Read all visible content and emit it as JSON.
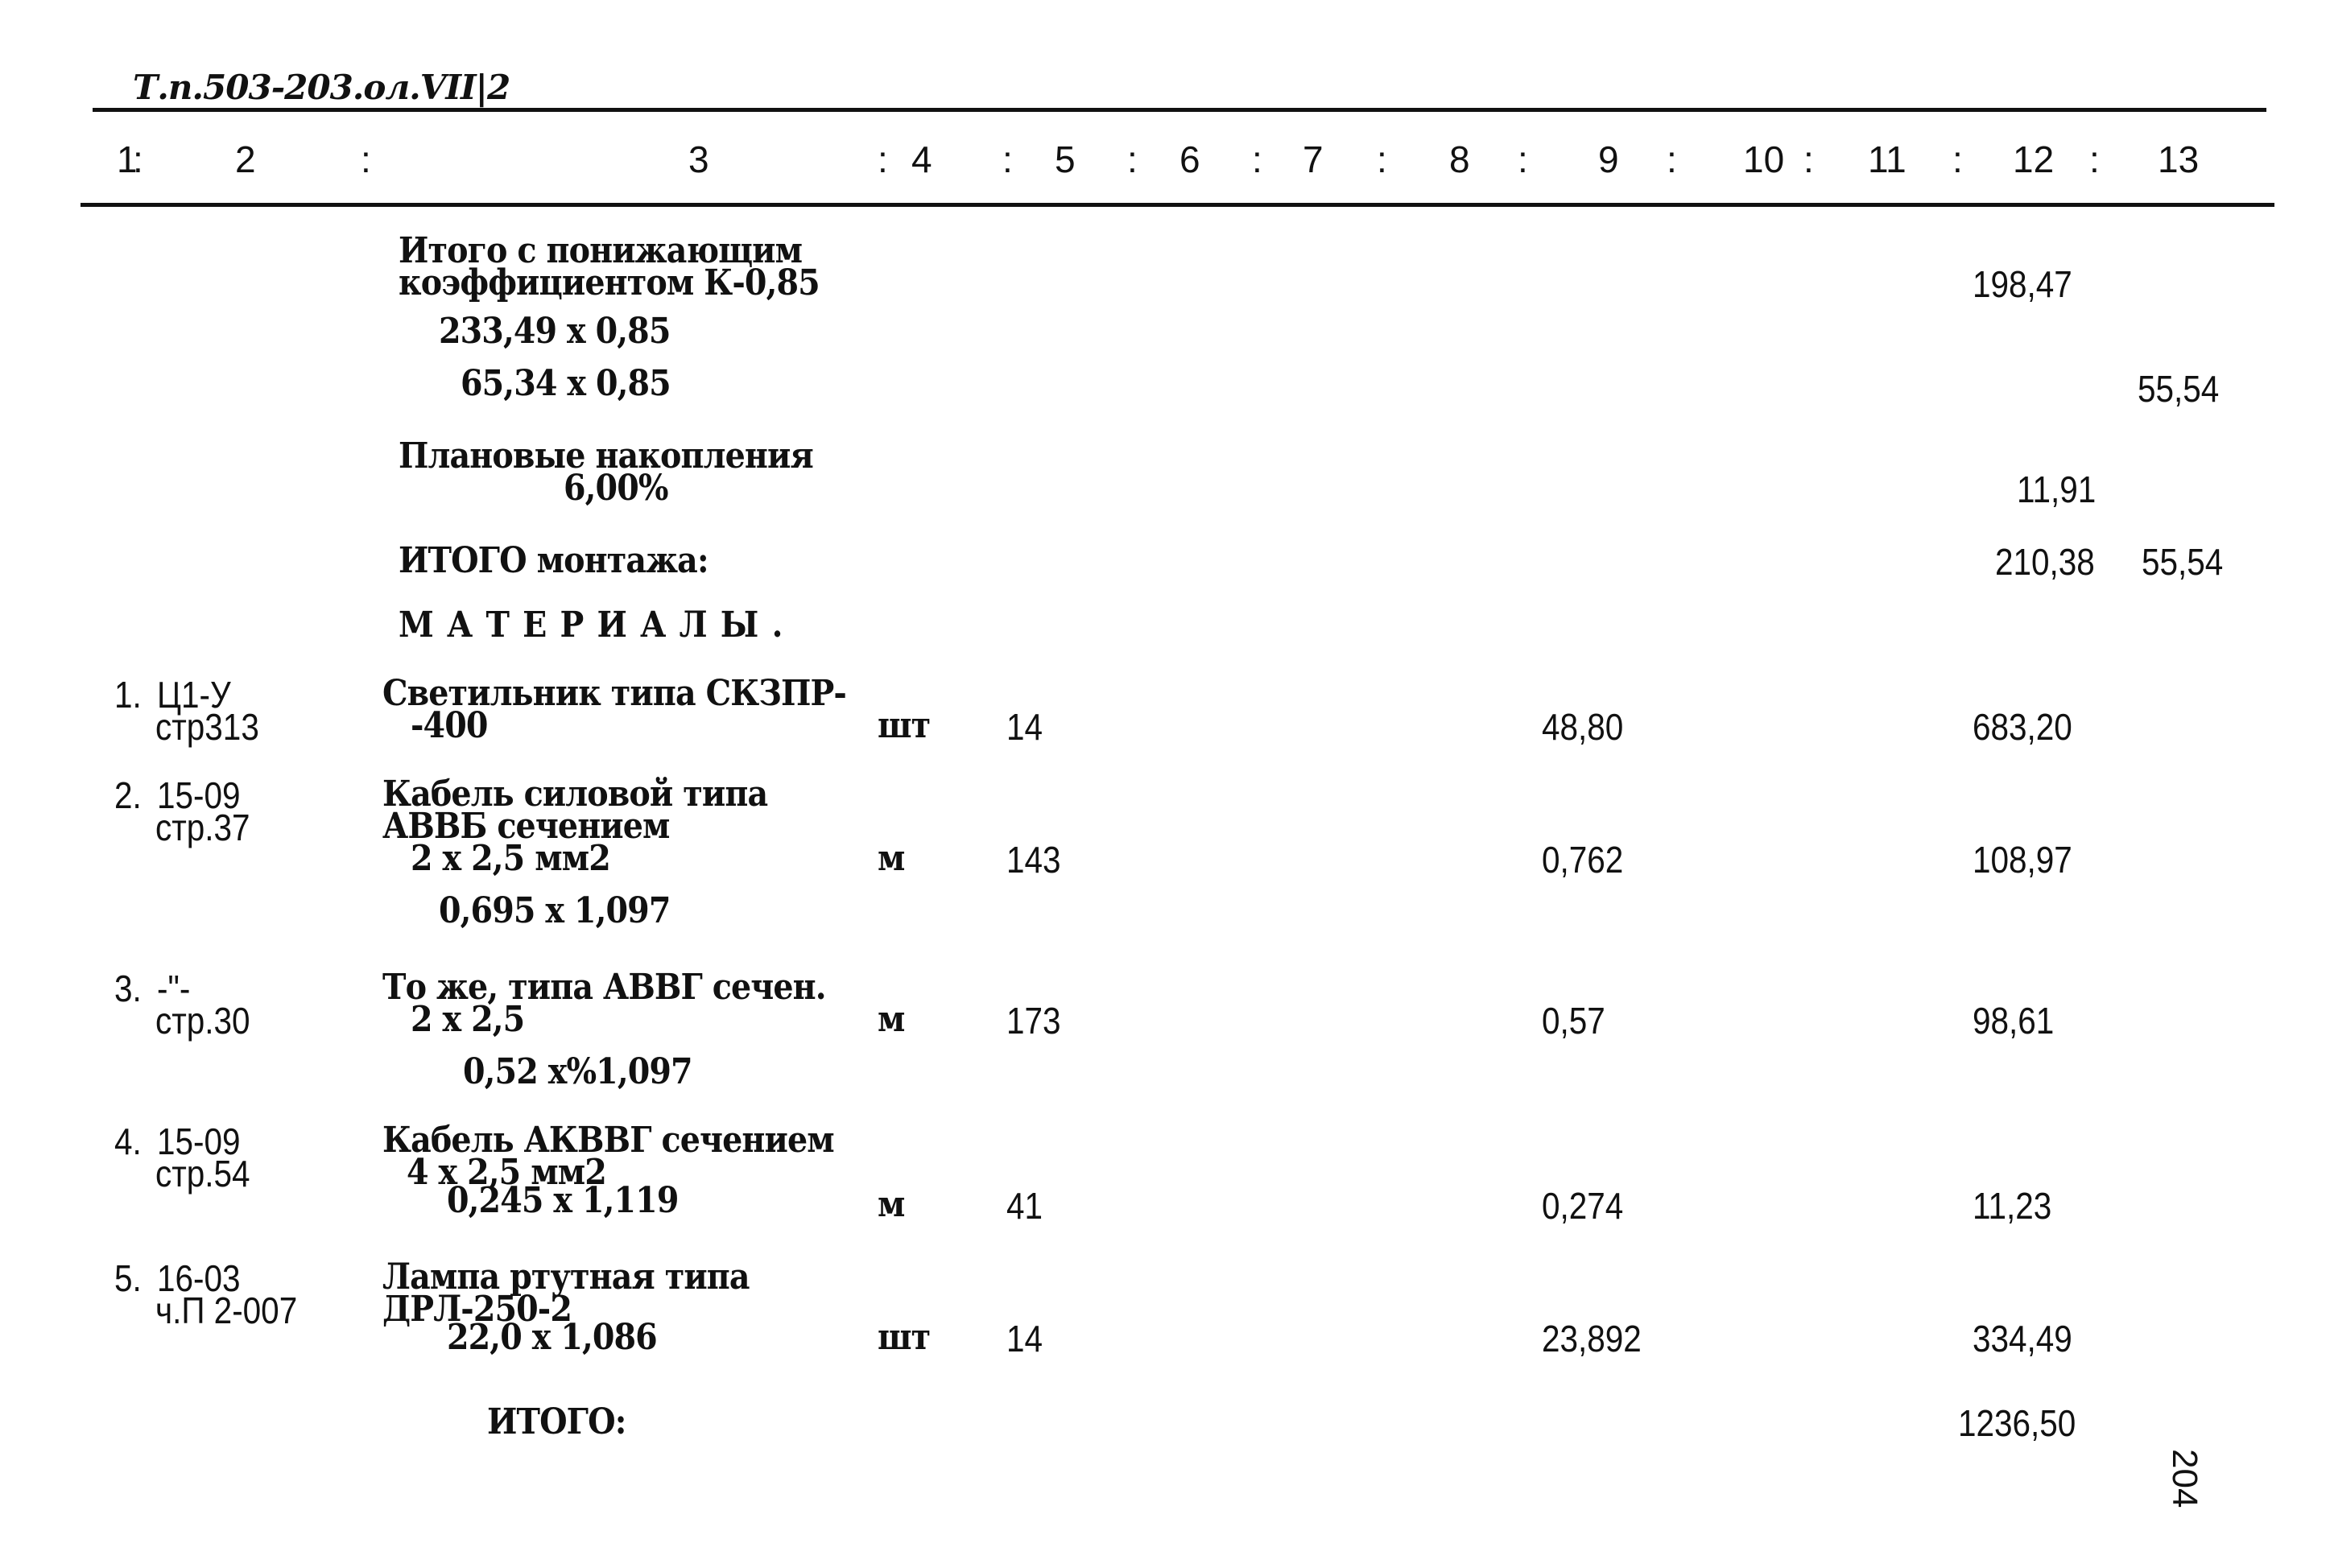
{
  "header": {
    "doc_code": "Т.п.503-203.ол.VII|2",
    "columns": [
      "1",
      "2",
      "3",
      "4",
      "5",
      "6",
      "7",
      "8",
      "9",
      "10",
      "11",
      "12",
      "13"
    ],
    "separator": ":"
  },
  "summary": {
    "reduced_total_label_1": "Итого с понижающим",
    "reduced_total_label_2": "коэффициентом К-0,85",
    "reduced_total_col12": "198,47",
    "calc_1": "233,49 х 0,85",
    "calc_2": "65,34 х 0,85",
    "calc_2_col13": "55,54",
    "planned_label": "Плановые накопления",
    "planned_pct": "6,00%",
    "planned_col12": "11,91",
    "install_total_label": "ИТОГО монтажа:",
    "install_total_col12": "210,38",
    "install_total_col13": "55,54"
  },
  "materials": {
    "section_title": "МАТЕРИАЛЫ.",
    "items": [
      {
        "no": "1.",
        "ref_line1": "Ц1-У",
        "ref_line2": "стр313",
        "desc": [
          "Светильник типа СКЗПР-",
          "-400"
        ],
        "unit": "шт",
        "qty": "14",
        "price": "48,80",
        "total": "683,20"
      },
      {
        "no": "2.",
        "ref_line1": "15-09",
        "ref_line2": "стр.37",
        "desc": [
          "Кабель силовой типа",
          "АВВБ сечением",
          "2 х 2,5 мм2",
          "0,695 х 1,097"
        ],
        "unit": "м",
        "qty": "143",
        "price": "0,762",
        "total": "108,97"
      },
      {
        "no": "3.",
        "ref_line1": "-\"-",
        "ref_line2": "стр.30",
        "desc": [
          "То же, типа АВВГ сечен.",
          "2 х 2,5",
          "0,52 х%1,097"
        ],
        "unit": "м",
        "qty": "173",
        "price": "0,57",
        "total": "98,61"
      },
      {
        "no": "4.",
        "ref_line1": "15-09",
        "ref_line2": "стр.54",
        "desc": [
          "Кабель АКВВГ сечением",
          "4 х 2,5 мм2",
          "0,245 х 1,119"
        ],
        "unit": "м",
        "qty": "41",
        "price": "0,274",
        "total": "11,23"
      },
      {
        "no": "5.",
        "ref_line1": "16-03",
        "ref_line2": "ч.П 2-007",
        "desc": [
          "Лампа ртутная типа",
          "ДРЛ-250-2",
          "22,0 х 1,086"
        ],
        "unit": "шт",
        "qty": "14",
        "price": "23,892",
        "total": "334,49"
      }
    ],
    "total_label": "ИТОГО:",
    "total_col12": "1236,50"
  },
  "page_number": "204"
}
